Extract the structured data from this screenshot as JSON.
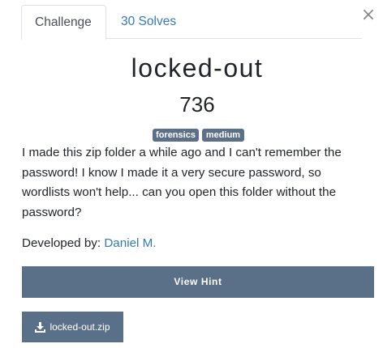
{
  "close_glyph": "×",
  "tabs": [
    {
      "label": "Challenge",
      "active": true
    },
    {
      "label": "30 Solves",
      "active": false
    }
  ],
  "challenge": {
    "name": "locked-out",
    "value": "736",
    "tags": [
      "forensics",
      "medium"
    ],
    "description": "I made this zip folder a while ago and I can't remember the password! I know I made it a very secure password, so wordlists won't help... can you open this folder without the password?",
    "developer_label": "Developed by:",
    "developer_name": "Daniel M."
  },
  "hint_button": "View Hint",
  "file": {
    "name": "locked-out.zip",
    "icon": "download-icon"
  },
  "colors": {
    "accent_link": "#337ab7",
    "button_bg": "#5a7089",
    "tag_bg": "#5c7089"
  }
}
